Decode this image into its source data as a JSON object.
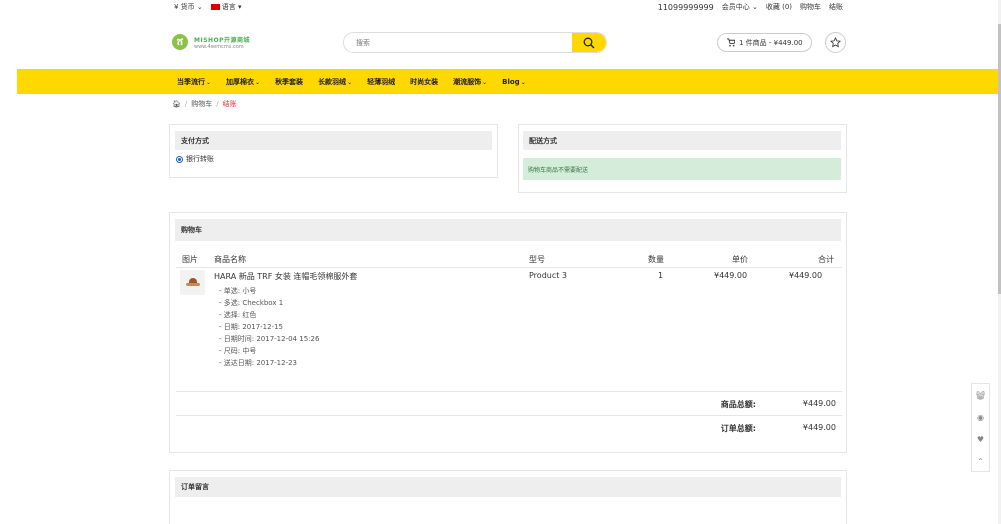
{
  "topbar": {
    "currency": "¥ 货币",
    "language": "语言",
    "phone": "11099999999",
    "member": "会员中心",
    "favorites": "收藏 (0)",
    "cart": "购物车",
    "checkout": "结账"
  },
  "header": {
    "logo_line1": "MISHOP开源商城",
    "logo_line2": "www.4semcms.com",
    "search_placeholder": "搜索",
    "cart_summary": "1 件商品 - ¥449.00"
  },
  "nav": {
    "items": [
      {
        "label": "当季流行",
        "has_dropdown": true
      },
      {
        "label": "加厚棉衣",
        "has_dropdown": true
      },
      {
        "label": "秋季套装",
        "has_dropdown": false
      },
      {
        "label": "长款羽绒",
        "has_dropdown": true
      },
      {
        "label": "轻薄羽绒",
        "has_dropdown": false
      },
      {
        "label": "时尚女装",
        "has_dropdown": false
      },
      {
        "label": "潮流服饰",
        "has_dropdown": true
      },
      {
        "label": "Blog",
        "has_dropdown": true
      }
    ]
  },
  "breadcrumb": {
    "items": [
      "购物车",
      "结账"
    ]
  },
  "payment": {
    "title": "支付方式",
    "option": "银行转账"
  },
  "shipping": {
    "title": "配送方式",
    "notice": "购物车商品不需要配送"
  },
  "cart": {
    "title": "购物车",
    "columns": [
      "图片",
      "商品名称",
      "型号",
      "数量",
      "单价",
      "合计"
    ],
    "item": {
      "name": "HARA 新品 TRF 女装 连帽毛领棉服外套",
      "options": [
        "- 单选: 小号",
        "- 多选: Checkbox 1",
        "- 选择: 红色",
        "- 日期: 2017-12-15",
        "- 日期时间: 2017-12-04 15:26",
        "- 尺码: 中号",
        "- 送达日期: 2017-12-23"
      ],
      "model": "Product 3",
      "qty": "1",
      "unit_price": "¥449.00",
      "total": "¥449.00"
    },
    "subtotal_label": "商品总额:",
    "subtotal_value": "¥449.00",
    "order_total_label": "订单总额:",
    "order_total_value": "¥449.00"
  },
  "comment": {
    "title": "订单留言"
  },
  "colors": {
    "accent": "#ffd800",
    "danger": "#e53935",
    "success_bg": "#d4edda"
  }
}
